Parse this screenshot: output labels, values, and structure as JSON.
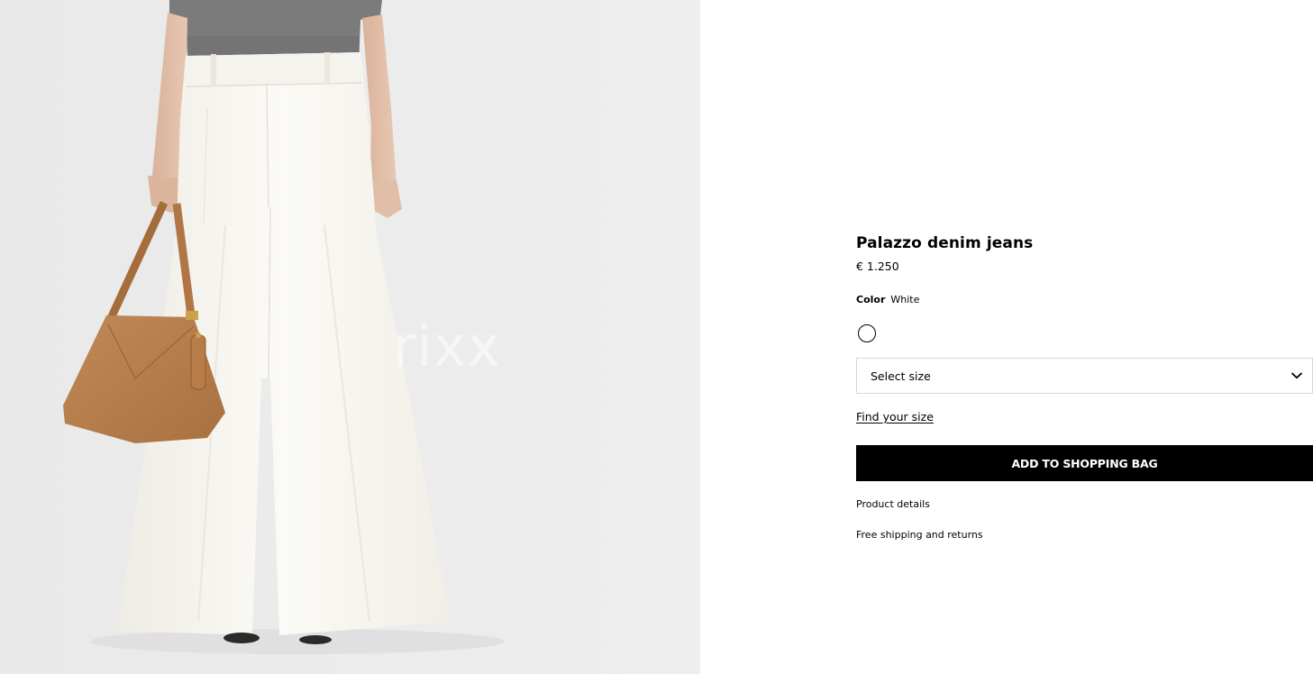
{
  "gallery": {
    "image_alt": "Model wearing white palazzo denim jeans with a tan leather shoulder bag",
    "watermark_text": "rixx"
  },
  "product": {
    "title": "Palazzo denim jeans",
    "price": "€ 1.250",
    "color": {
      "label": "Color",
      "value": "White",
      "swatches": [
        {
          "name": "White",
          "hex": "#ffffff",
          "selected": true
        }
      ]
    },
    "size_select": {
      "placeholder": "Select size"
    },
    "find_size_link": "Find your size",
    "add_to_bag_label": "ADD TO SHOPPING BAG",
    "product_details_label": "Product details",
    "shipping_label": "Free shipping and returns"
  },
  "colors": {
    "image_background": "#ececec",
    "button_background": "#000000",
    "button_text": "#ffffff",
    "border": "#d6d6d6"
  }
}
